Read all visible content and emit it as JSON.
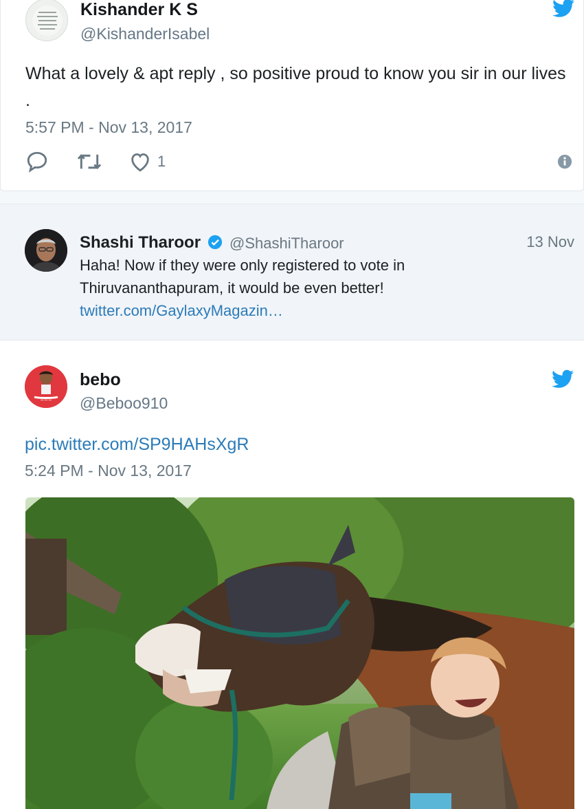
{
  "tweet1": {
    "author_name": "Kishander K S",
    "author_handle": "@KishanderIsabel",
    "text": "What a lovely & apt reply , so positive proud to know you sir in our lives .",
    "timestamp": "5:57 PM - Nov 13, 2017",
    "like_count": "1"
  },
  "quote": {
    "author_name": "Shashi Tharoor",
    "author_handle": "@ShashiTharoor",
    "date": "13 Nov",
    "text_line1": "Haha! Now if they were only registered to vote in",
    "text_line2": "Thiruvananthapuram, it would be even better!",
    "link": "twitter.com/GaylaxyMagazin…"
  },
  "tweet2": {
    "author_name": "bebo",
    "author_handle": "@Beboo910",
    "link": "pic.twitter.com/SP9HAHsXgR",
    "timestamp": "5:24 PM - Nov 13, 2017"
  },
  "colors": {
    "twitter_blue": "#1da1f2",
    "link_blue": "#2b7bb9",
    "verified": "#1da1f2"
  }
}
